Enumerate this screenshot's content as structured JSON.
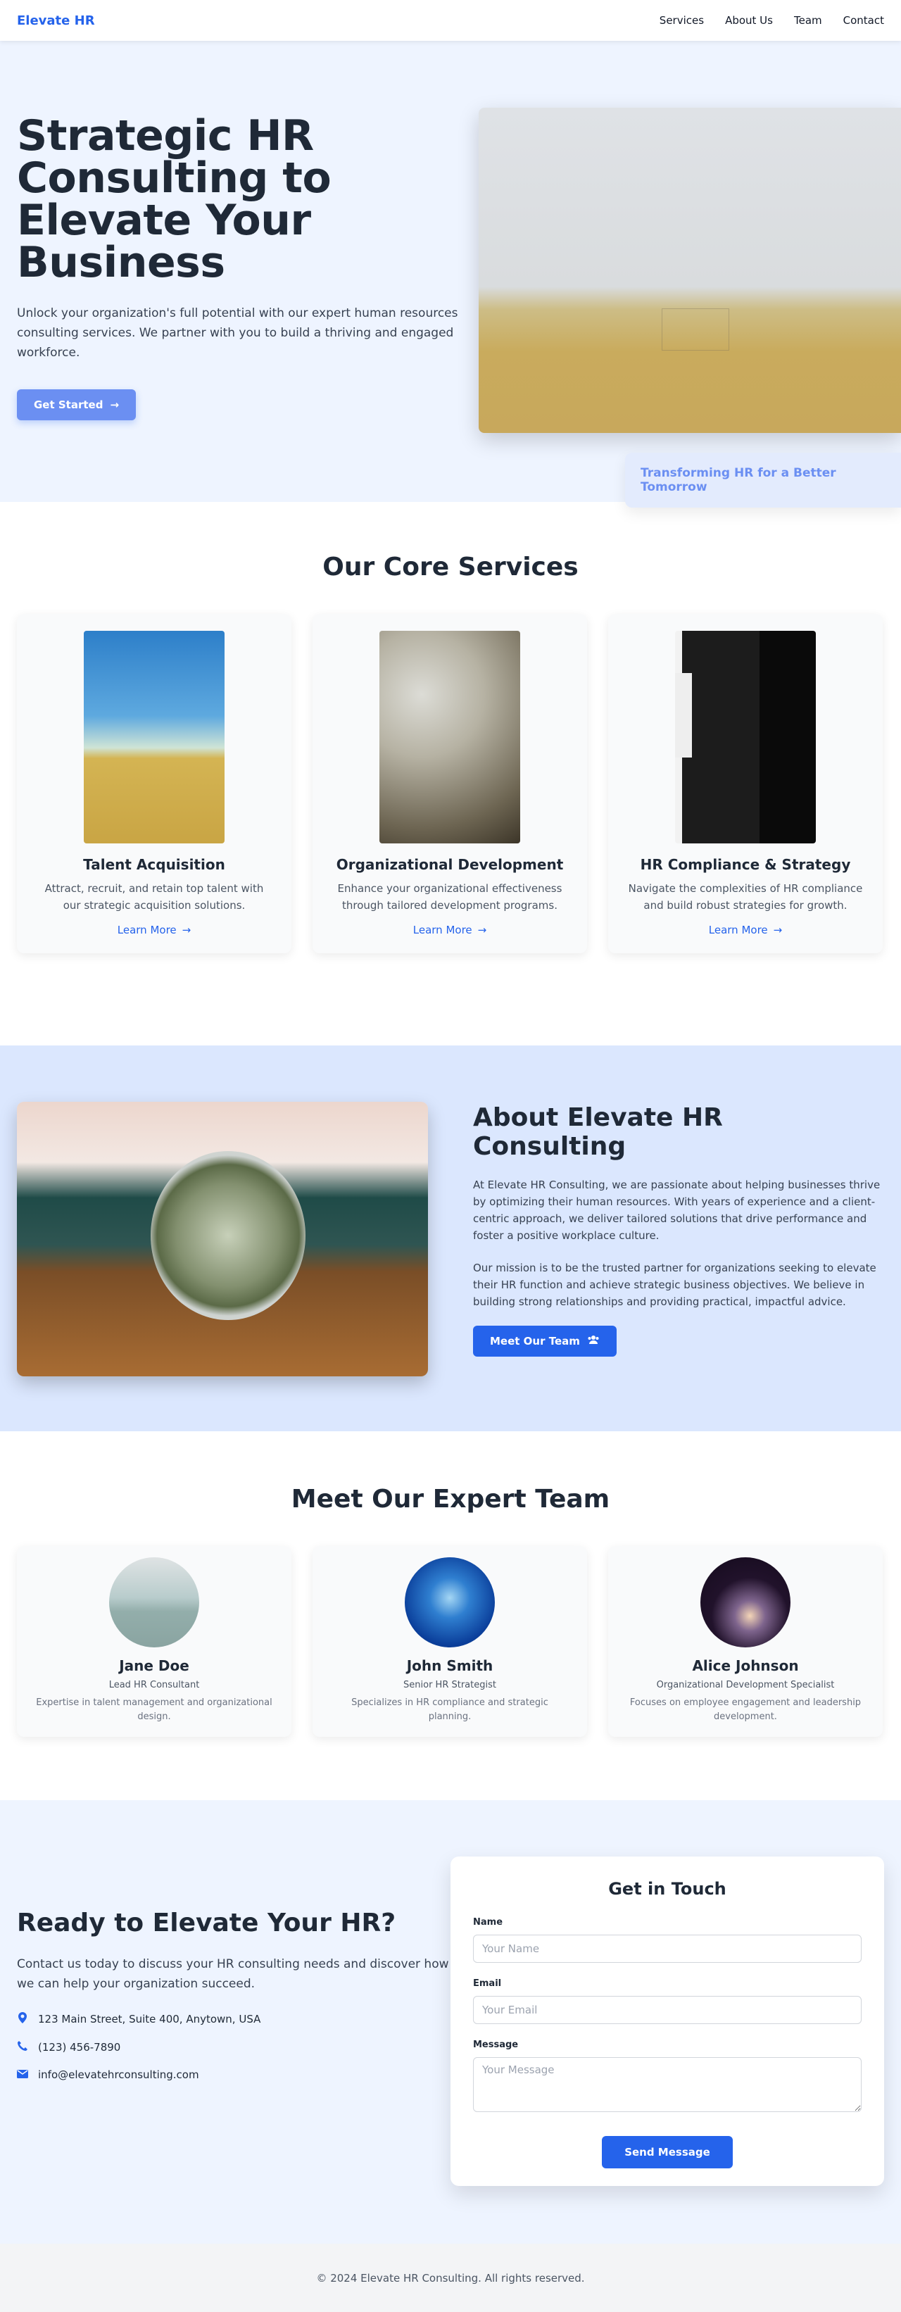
{
  "nav": {
    "brand": "Elevate HR",
    "links": [
      "Services",
      "About Us",
      "Team",
      "Contact"
    ]
  },
  "hero": {
    "title": "Strategic HR Consulting to Elevate Your Business",
    "subtitle": "Unlock your organization's full potential with our expert human resources consulting services. We partner with you to build a thriving and engaged workforce.",
    "cta_label": "Get Started",
    "caption": "Transforming HR for a Better Tomorrow"
  },
  "services": {
    "title": "Our Core Services",
    "items": [
      {
        "title": "Talent Acquisition",
        "text": "Attract, recruit, and retain top talent with our strategic acquisition solutions.",
        "link": "Learn More"
      },
      {
        "title": "Organizational Development",
        "text": "Enhance your organizational effectiveness through tailored development programs.",
        "link": "Learn More"
      },
      {
        "title": "HR Compliance & Strategy",
        "text": "Navigate the complexities of HR compliance and build robust strategies for growth.",
        "link": "Learn More"
      }
    ]
  },
  "about": {
    "title": "About Elevate HR Consulting",
    "p1": "At Elevate HR Consulting, we are passionate about helping businesses thrive by optimizing their human resources. With years of experience and a client-centric approach, we deliver tailored solutions that drive performance and foster a positive workplace culture.",
    "p2": "Our mission is to be the trusted partner for organizations seeking to elevate their HR function and achieve strategic business objectives. We believe in building strong relationships and providing practical, impactful advice.",
    "cta_label": "Meet Our Team"
  },
  "team": {
    "title": "Meet Our Expert Team",
    "members": [
      {
        "name": "Jane Doe",
        "role": "Lead HR Consultant",
        "desc": "Expertise in talent management and organizational design."
      },
      {
        "name": "John Smith",
        "role": "Senior HR Strategist",
        "desc": "Specializes in HR compliance and strategic planning."
      },
      {
        "name": "Alice Johnson",
        "role": "Organizational Development Specialist",
        "desc": "Focuses on employee engagement and leadership development."
      }
    ]
  },
  "contact": {
    "title": "Ready to Elevate Your HR?",
    "text": "Contact us today to discuss your HR consulting needs and discover how we can help your organization succeed.",
    "address": "123 Main Street, Suite 400, Anytown, USA",
    "phone": "(123) 456-7890",
    "email": "info@elevatehrconsulting.com",
    "form": {
      "title": "Get in Touch",
      "name_label": "Name",
      "name_placeholder": "Your Name",
      "email_label": "Email",
      "email_placeholder": "Your Email",
      "message_label": "Message",
      "message_placeholder": "Your Message",
      "submit_label": "Send Message"
    }
  },
  "footer": {
    "text": "© 2024 Elevate HR Consulting. All rights reserved."
  },
  "colors": {
    "accent": "#2563eb",
    "hero_bg": "#eef4ff",
    "about_bg": "#dbe7fe"
  },
  "icons": {
    "address": "map-marker-icon",
    "phone": "phone-icon",
    "email": "envelope-icon",
    "arrow": "arrow-right-icon",
    "team": "users-icon"
  }
}
